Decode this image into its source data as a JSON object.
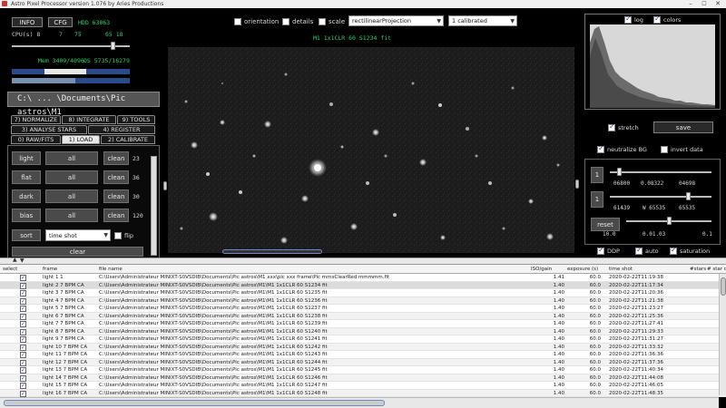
{
  "window": {
    "title": "Astro Pixel Processor version 1.076 by Aries Productions"
  },
  "top_left": {
    "info_btn": "INFO",
    "cfg_btn": "CFG",
    "hdd": "HDD 63063",
    "cpu_label": "CPU(s) 8",
    "cpu_val1": "7",
    "cpu_val2": "75",
    "cpu_val3": "65 18",
    "mem": "Mem 3409/4096",
    "os": "OS 5735/16279"
  },
  "path": "C:\\ ... \\Documents\\Pic astros\\M1",
  "tabs": {
    "row1": [
      "7) NORMALIZE",
      "8) INTEGRATE",
      "9) TOOLS"
    ],
    "row2": [
      "3) ANALYSE STARS",
      "4) REGISTER"
    ],
    "row3": [
      "0) RAW/FITS",
      "1) LOAD",
      "2) CALIBRATE"
    ]
  },
  "load_panel": {
    "rows": [
      {
        "type": "light",
        "all": "all",
        "clean": "clean",
        "count": "23"
      },
      {
        "type": "flat",
        "all": "all",
        "clean": "clean",
        "count": "36"
      },
      {
        "type": "dark",
        "all": "all",
        "clean": "clean",
        "count": "30"
      },
      {
        "type": "bias",
        "all": "all",
        "clean": "clean",
        "count": "120"
      }
    ],
    "sort_label": "sort",
    "sort_value": "time shot",
    "flip_label": "flip",
    "clear_label": "clear"
  },
  "image_toolbar": {
    "orientation": "orientation",
    "details": "details",
    "scale": "scale",
    "projection": "rectilinearProjection",
    "calibration": "1 calibrated",
    "filename": "M1 1x1CLR 60 S1234 fit"
  },
  "right_panel": {
    "log": "log",
    "colors": "colors",
    "stretch": "stretch",
    "save": "save",
    "neutralize_bg": "neutralize BG",
    "invert_data": "invert data",
    "r1_num": "1",
    "r1_vals": [
      "06800",
      "0.08322",
      "04698"
    ],
    "r2_num": "1",
    "r2_vals": [
      "61439",
      "W 65535",
      "65535"
    ],
    "reset": "reset",
    "reset_vals": [
      "10.0",
      "0.01.03",
      "0.1"
    ],
    "ddp": "DDP",
    "auto": "auto",
    "saturation": "saturation"
  },
  "table": {
    "headers": [
      "select",
      "frame",
      "file name",
      "ISO/gain",
      "exposure (s)",
      "time shot",
      "#stars",
      "# star de"
    ],
    "rows": [
      {
        "frame": "light 1 1",
        "file": "C:\\Users\\Administrateur MINIXT-S0VSDIB\\Documents\\Pic astros\\M1 xxx\\pic xxx frame\\Pic mmsClearRed mmmmm.fit",
        "iso": "1.41",
        "exp": "60.0",
        "time": "2020-02-22T11:19:38",
        "stars": ""
      },
      {
        "frame": "light 2 7 BPM CA",
        "file": "C:\\Users\\Administrateur MINIXT-S0VSDIB\\Documents\\Pic astros\\M1\\M1 1x1CLR 60 S1234 fit",
        "iso": "1.40",
        "exp": "60.0",
        "time": "2020-02-22T11:17:34",
        "stars": ""
      },
      {
        "frame": "light 3 7 BPM CA",
        "file": "C:\\Users\\Administrateur MINIXT-S0VSDIB\\Documents\\Pic astros\\M1\\M1 1x1CLR 60 S1235 fit",
        "iso": "1.40",
        "exp": "60.0",
        "time": "2020-02-22T11:20:36",
        "stars": ""
      },
      {
        "frame": "light 4 7 BPM CA",
        "file": "C:\\Users\\Administrateur MINIXT-S0VSDIB\\Documents\\Pic astros\\M1\\M1 1x1CLR 60 S1236 fit",
        "iso": "1.40",
        "exp": "60.0",
        "time": "2020-02-22T11:21:38",
        "stars": ""
      },
      {
        "frame": "light 5 7 BPM CA",
        "file": "C:\\Users\\Administrateur MINIXT-S0VSDIB\\Documents\\Pic astros\\M1\\M1 1x1CLR 60 S1237 fit",
        "iso": "1.40",
        "exp": "60.0",
        "time": "2020-02-22T11:23:27",
        "stars": ""
      },
      {
        "frame": "light 6 7 BPM CA",
        "file": "C:\\Users\\Administrateur MINIXT-S0VSDIB\\Documents\\Pic astros\\M1\\M1 1x1CLR 60 S1238 fit",
        "iso": "1.40",
        "exp": "60.0",
        "time": "2020-02-22T11:25:36",
        "stars": ""
      },
      {
        "frame": "light 7 7 BPM CA",
        "file": "C:\\Users\\Administrateur MINIXT-S0VSDIB\\Documents\\Pic astros\\M1\\M1 1x1CLR 60 S1239 fit",
        "iso": "1.40",
        "exp": "60.0",
        "time": "2020-02-22T11:27:41",
        "stars": ""
      },
      {
        "frame": "light 8 7 BPM CA",
        "file": "C:\\Users\\Administrateur MINIXT-S0VSDIB\\Documents\\Pic astros\\M1\\M1 1x1CLR 60 S1240 fit",
        "iso": "1.40",
        "exp": "60.0",
        "time": "2020-02-22T11:29:33",
        "stars": ""
      },
      {
        "frame": "light 9 7 BPM CA",
        "file": "C:\\Users\\Administrateur MINIXT-S0VSDIB\\Documents\\Pic astros\\M1\\M1 1x1CLR 60 S1241 fit",
        "iso": "1.40",
        "exp": "60.0",
        "time": "2020-02-22T11:31:27",
        "stars": ""
      },
      {
        "frame": "light 10 7 BPM CA",
        "file": "C:\\Users\\Administrateur MINIXT-S0VSDIB\\Documents\\Pic astros\\M1\\M1 1x1CLR 60 S1242 fit",
        "iso": "1.40",
        "exp": "60.0",
        "time": "2020-02-22T11:33:32",
        "stars": ""
      },
      {
        "frame": "light 11 7 BPM CA",
        "file": "C:\\Users\\Administrateur MINIXT-S0VSDIB\\Documents\\Pic astros\\M1\\M1 1x1CLR 60 S1243 fit",
        "iso": "1.40",
        "exp": "60.0",
        "time": "2020-02-22T11:36:36",
        "stars": ""
      },
      {
        "frame": "light 12 7 BPM CA",
        "file": "C:\\Users\\Administrateur MINIXT-S0VSDIB\\Documents\\Pic astros\\M1\\M1 1x1CLR 60 S1244 fit",
        "iso": "1.40",
        "exp": "60.0",
        "time": "2020-02-22T11:37:36",
        "stars": ""
      },
      {
        "frame": "light 13 7 BPM CA",
        "file": "C:\\Users\\Administrateur MINIXT-S0VSDIB\\Documents\\Pic astros\\M1\\M1 1x1CLR 60 S1245 fit",
        "iso": "1.40",
        "exp": "60.0",
        "time": "2020-02-22T11:40:34",
        "stars": ""
      },
      {
        "frame": "light 14 7 BPM CA",
        "file": "C:\\Users\\Administrateur MINIXT-S0VSDIB\\Documents\\Pic astros\\M1\\M1 1x1CLR 60 S1246 fit",
        "iso": "1.40",
        "exp": "60.0",
        "time": "2020-02-22T11:44:08",
        "stars": ""
      },
      {
        "frame": "light 15 7 BPM CA",
        "file": "C:\\Users\\Administrateur MINIXT-S0VSDIB\\Documents\\Pic astros\\M1\\M1 1x1CLR 60 S1247 fit",
        "iso": "1.40",
        "exp": "60.0",
        "time": "2020-02-22T11:46:05",
        "stars": ""
      },
      {
        "frame": "light 16 7 BPM CA",
        "file": "C:\\Users\\Administrateur MINIXT-S0VSDIB\\Documents\\Pic astros\\M1\\M1 1x1CLR 60 S1248 fit",
        "iso": "1.40",
        "exp": "60.0",
        "time": "2020-02-22T11:48:35",
        "stars": ""
      }
    ]
  }
}
